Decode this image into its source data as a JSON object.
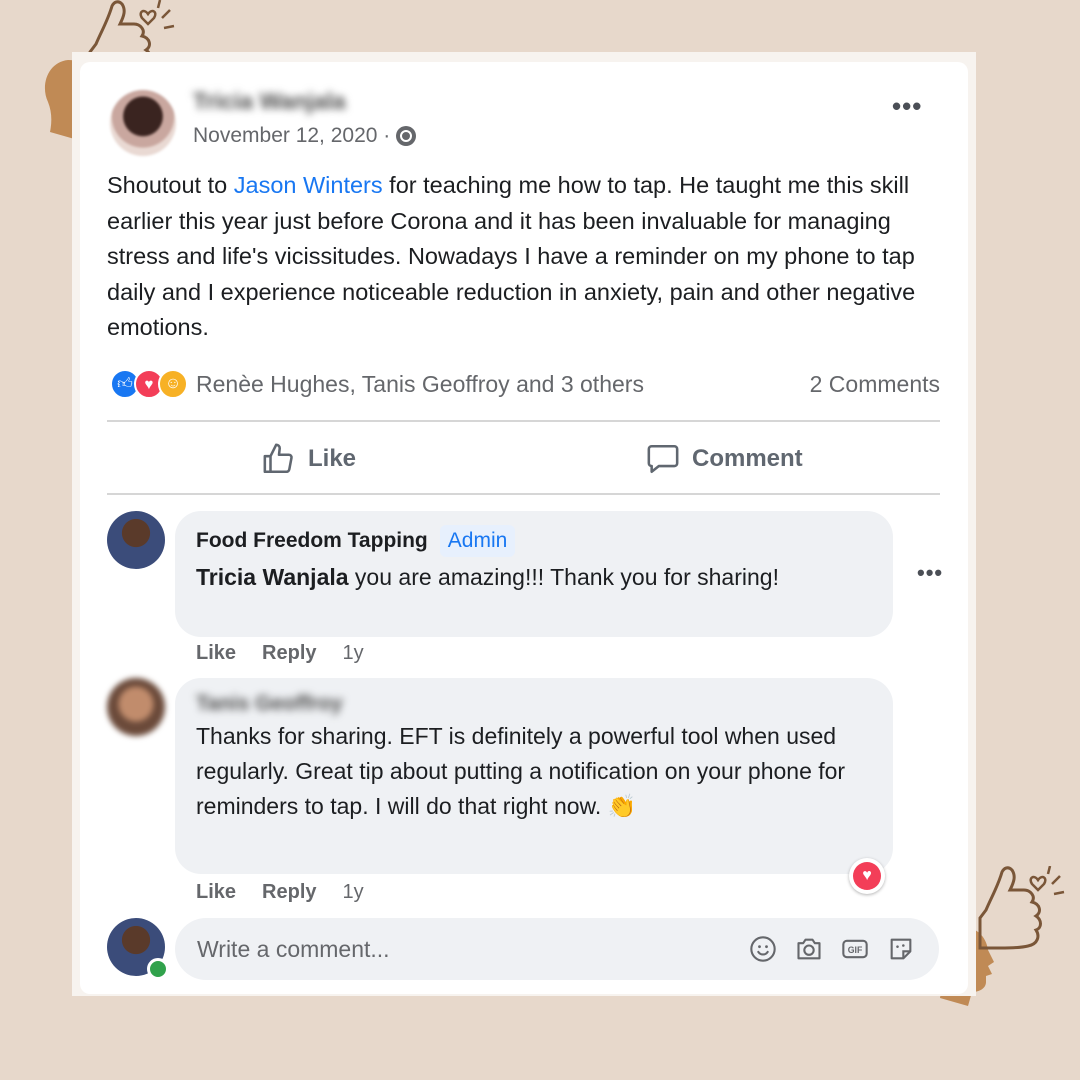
{
  "post": {
    "author": "Tricia Wanjala",
    "date": "November 12, 2020 ·",
    "text_before": "Shoutout to ",
    "mention": "Jason Winters",
    "text_after": " for teaching me how to tap. He taught me this skill earlier this year just before Corona and it has been invaluable for managing stress and life's vicissitudes. Nowadays I have a reminder on my phone to tap daily and I experience noticeable reduction in anxiety, pain and other negative emotions.",
    "more_icon": "•••",
    "reactions_text": "Renèe Hughes, Tanis Geoffroy and 3 others",
    "comments_count": "2 Comments",
    "actions": {
      "like": "Like",
      "comment": "Comment"
    }
  },
  "comments": [
    {
      "name": "Food Freedom Tapping",
      "badge": "Admin",
      "mention": "Tricia Wanjala",
      "text": " you are amazing!!! Thank you for sharing!",
      "like": "Like",
      "reply": "Reply",
      "age": "1y"
    },
    {
      "name": "Tanis Geoffroy",
      "text": "Thanks for sharing. EFT is definitely a powerful tool when used regularly. Great tip about putting a notification on your phone for reminders to tap. I will do that right now. 👏",
      "like": "Like",
      "reply": "Reply",
      "age": "1y"
    }
  ],
  "composer": {
    "placeholder": "Write a comment...",
    "icons": [
      "emoji-icon",
      "camera-icon",
      "gif-icon",
      "sticker-icon"
    ]
  },
  "colors": {
    "accent": "#1877f2",
    "background": "#e7d8cb",
    "deco": "#c08a55"
  }
}
